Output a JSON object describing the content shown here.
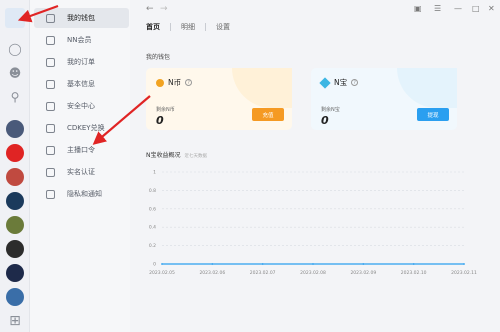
{
  "nav": {
    "items": [
      {
        "label": "我的钱包",
        "active": true
      },
      {
        "label": "NN会员"
      },
      {
        "label": "我的订单"
      },
      {
        "label": "基本信息"
      },
      {
        "label": "安全中心"
      },
      {
        "label": "CDKEY兑换"
      },
      {
        "label": "主播口令"
      },
      {
        "label": "实名认证"
      },
      {
        "label": "隐私和通知"
      }
    ]
  },
  "tabs": [
    {
      "label": "首页",
      "active": true
    },
    {
      "label": "明细"
    },
    {
      "label": "设置"
    }
  ],
  "wallet": {
    "title": "我的钱包",
    "nb": {
      "name": "N币",
      "balance_label": "剩余N币",
      "balance": "0",
      "button": "充值"
    },
    "nz": {
      "name": "N宝",
      "balance_label": "剩余N宝",
      "balance": "0",
      "button": "提现"
    }
  },
  "chart_title": "N宝收益概况",
  "chart_subtitle": "近七天数据",
  "colors": {
    "accent_orange": "#f59a23",
    "accent_blue": "#2a9ff0",
    "arrow_red": "#e02424"
  },
  "chart_data": {
    "type": "line",
    "x": [
      "2023.02.05",
      "2023.02.06",
      "2023.02.07",
      "2023.02.08",
      "2023.02.09",
      "2023.02.10",
      "2023.02.11"
    ],
    "series": [
      {
        "values": [
          0,
          0,
          0,
          0,
          0,
          0,
          0
        ],
        "color": "#2a9ff0"
      }
    ],
    "yticks": [
      "0",
      "0.2",
      "0.4",
      "0.6",
      "0.8",
      "1"
    ],
    "ylim": [
      0,
      1
    ],
    "grid": true
  }
}
